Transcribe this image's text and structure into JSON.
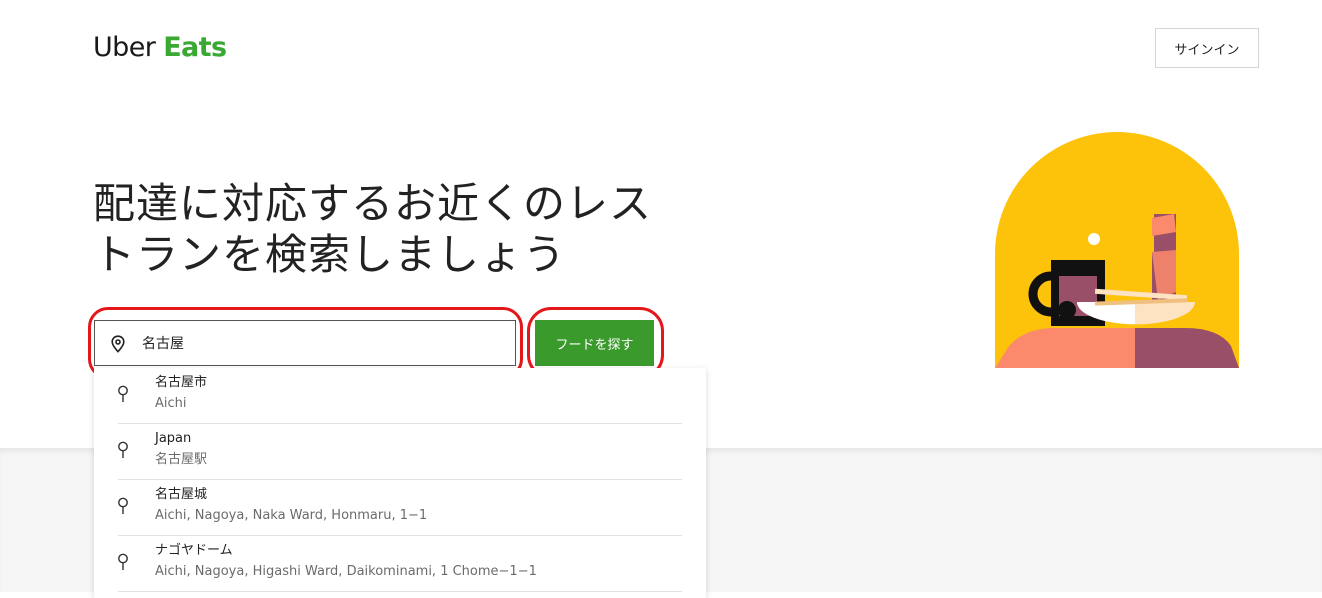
{
  "header": {
    "logo_uber": "Uber",
    "logo_eats": "Eats",
    "signin_label": "サインイン"
  },
  "hero": {
    "headline_line1": "配達に対応するお近くのレス",
    "headline_line2": "トランを検索しましょう",
    "illustration_icon": "coffee-and-food-illustration"
  },
  "search": {
    "value": "名古屋",
    "icon": "location-pin-icon",
    "button_label": "フードを探す"
  },
  "suggestions": [
    {
      "primary": "名古屋市",
      "secondary": "Aichi"
    },
    {
      "primary": "Japan",
      "secondary": "名古屋駅"
    },
    {
      "primary": "名古屋城",
      "secondary": "Aichi, Nagoya, Naka Ward, Honmaru, 1−1"
    },
    {
      "primary": "ナゴヤドーム",
      "secondary": "Aichi, Nagoya, Higashi Ward, Daikominami, 1 Chome−1−1"
    }
  ],
  "colors": {
    "brand_green": "#3aa832",
    "button_green": "#3a9a2c",
    "highlight_red": "#e4171b",
    "hero_yellow": "#fdc20a"
  }
}
